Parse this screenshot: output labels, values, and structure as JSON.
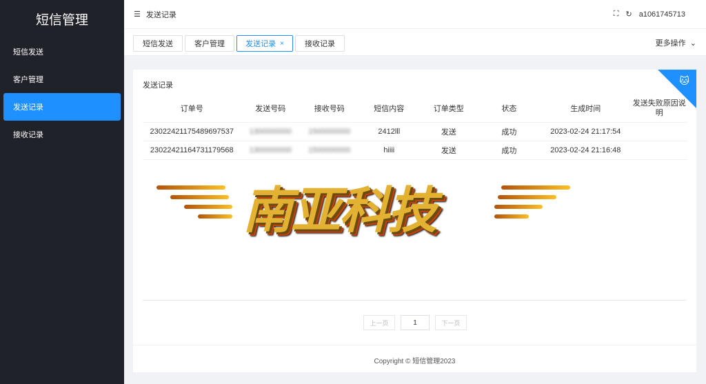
{
  "app": {
    "brand": "短信管理"
  },
  "sidebar": {
    "items": [
      {
        "label": "短信发送"
      },
      {
        "label": "客户管理"
      },
      {
        "label": "发送记录"
      },
      {
        "label": "接收记录"
      }
    ]
  },
  "header": {
    "breadcrumb": "发送记录",
    "user": "a1061745713"
  },
  "tabs": [
    {
      "label": "短信发送"
    },
    {
      "label": "客户管理"
    },
    {
      "label": "发送记录",
      "close": "×"
    },
    {
      "label": "接收记录"
    }
  ],
  "more_actions": "更多操作",
  "card": {
    "title": "发送记录"
  },
  "table": {
    "headers": [
      "订单号",
      "发送号码",
      "接收号码",
      "短信内容",
      "订单类型",
      "状态",
      "生成时间",
      "发送失败原因说明"
    ],
    "rows": [
      {
        "order": "23022421175489697537",
        "from": "1300000000",
        "to": "1500000000",
        "content": "2412lll",
        "type": "发送",
        "status": "成功",
        "time": "2023-02-24 21:17:54",
        "reason": ""
      },
      {
        "order": "23022421164731179568",
        "from": "1300000000",
        "to": "1500000000",
        "content": "hiiii",
        "type": "发送",
        "status": "成功",
        "time": "2023-02-24 21:16:48",
        "reason": ""
      }
    ]
  },
  "logo": {
    "text": "南亚科技"
  },
  "pager": {
    "prev": "上一页",
    "page": "1",
    "next": "下一页"
  },
  "footer": {
    "copyright": "Copyright © 短信管理2023"
  }
}
